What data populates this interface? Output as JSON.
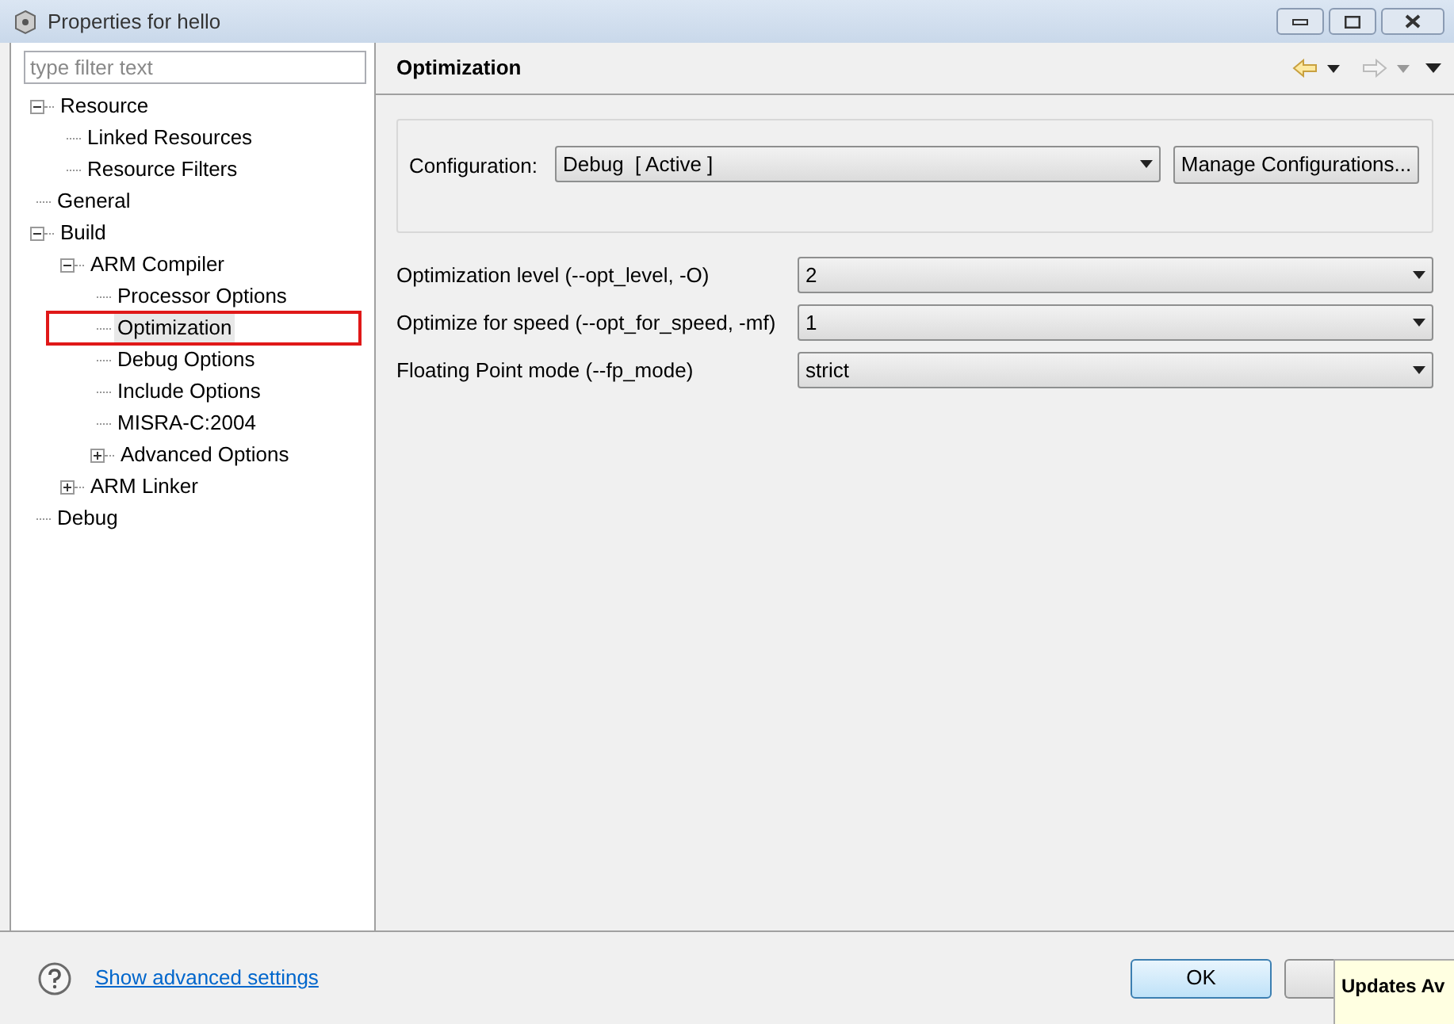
{
  "window": {
    "title": "Properties for hello"
  },
  "filter": {
    "placeholder": "type filter text"
  },
  "tree": [
    {
      "label": "Resource",
      "expanded": true,
      "selected": false,
      "children": [
        {
          "label": "Linked Resources",
          "selected": false
        },
        {
          "label": "Resource Filters",
          "selected": false
        }
      ]
    },
    {
      "label": "General",
      "selected": false
    },
    {
      "label": "Build",
      "expanded": true,
      "selected": false,
      "children": [
        {
          "label": "ARM Compiler",
          "expanded": true,
          "selected": false,
          "children": [
            {
              "label": "Processor Options",
              "selected": false
            },
            {
              "label": "Optimization",
              "selected": true,
              "highlighted": true
            },
            {
              "label": "Debug Options",
              "selected": false
            },
            {
              "label": "Include Options",
              "selected": false
            },
            {
              "label": "MISRA-C:2004",
              "selected": false
            },
            {
              "label": "Advanced Options",
              "expanded": false,
              "selected": false
            }
          ]
        },
        {
          "label": "ARM Linker",
          "expanded": false,
          "selected": false
        }
      ]
    },
    {
      "label": "Debug",
      "selected": false
    }
  ],
  "page": {
    "title": "Optimization",
    "configuration": {
      "label": "Configuration:",
      "value": "Debug  [ Active ]",
      "button": "Manage Configurations..."
    },
    "options": [
      {
        "label": "Optimization level (--opt_level, -O)",
        "value": "2"
      },
      {
        "label": "Optimize for speed (--opt_for_speed, -mf)",
        "value": "1"
      },
      {
        "label": "Floating Point mode (--fp_mode)",
        "value": "strict"
      }
    ]
  },
  "footer": {
    "link": "Show advanced settings",
    "ok": "OK"
  },
  "notification": {
    "title": "Updates Av"
  }
}
